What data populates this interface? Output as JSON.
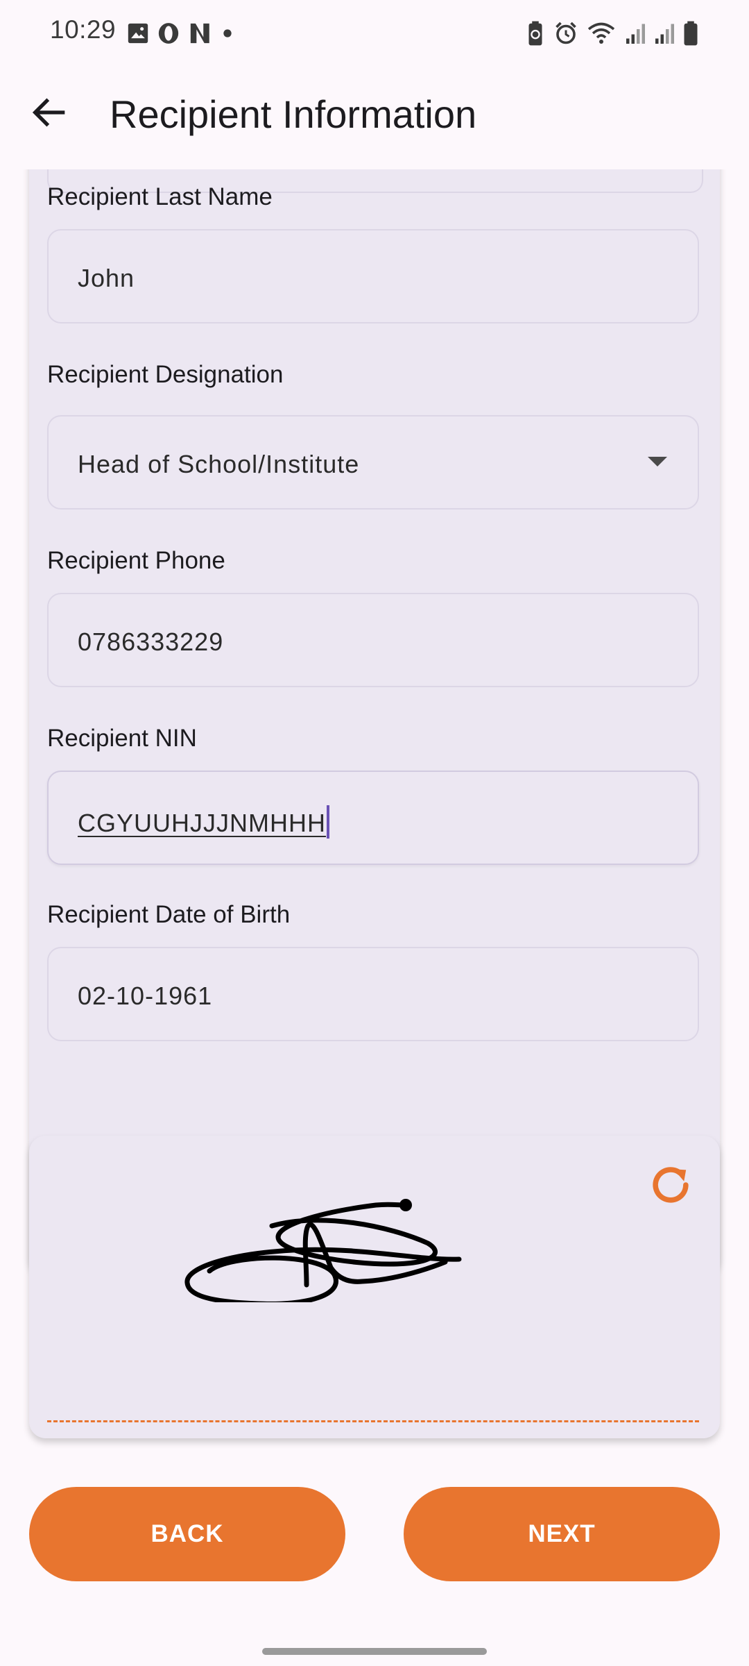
{
  "status_bar": {
    "time": "10:29",
    "left_icons": [
      "gallery-icon",
      "opera-icon",
      "netflix-icon",
      "dot-icon"
    ],
    "right_icons": [
      "battery-saver-icon",
      "alarm-icon",
      "wifi-icon",
      "signal-icon",
      "signal-icon",
      "battery-icon"
    ]
  },
  "app_bar": {
    "back_icon": "arrow-left-icon",
    "title": "Recipient Information"
  },
  "form": {
    "last_name": {
      "label": "Recipient Last Name",
      "value": "John"
    },
    "designation": {
      "label": "Recipient Designation",
      "value": "Head of School/Institute"
    },
    "phone": {
      "label": "Recipient Phone",
      "value": "0786333229"
    },
    "nin": {
      "label": "Recipient NIN",
      "value": "CGYUUHJJJNMHHH",
      "focused": true
    },
    "dob": {
      "label": "Recipient Date of Birth",
      "value": "02-10-1961"
    }
  },
  "signature": {
    "clear_icon": "refresh-icon",
    "has_signature": true
  },
  "actions": {
    "back_label": "BACK",
    "next_label": "NEXT"
  },
  "colors": {
    "accent": "#e8752f",
    "card": "#ece7f2",
    "background": "#fdf8fc",
    "caret": "#6a52b5"
  }
}
